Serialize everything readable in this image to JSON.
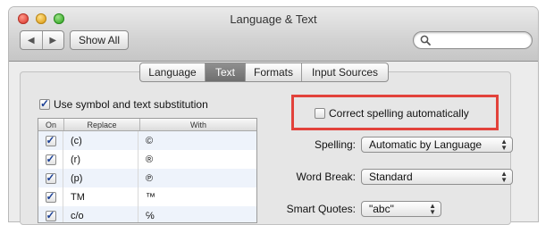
{
  "window": {
    "title": "Language & Text"
  },
  "toolbar": {
    "back_glyph": "◀",
    "forward_glyph": "▶",
    "show_all_label": "Show All",
    "search_placeholder": ""
  },
  "tabs": [
    {
      "label": "Language",
      "active": false
    },
    {
      "label": "Text",
      "active": true
    },
    {
      "label": "Formats",
      "active": false
    },
    {
      "label": "Input Sources",
      "active": false
    }
  ],
  "substitution": {
    "checkbox_label": "Use symbol and text substitution",
    "checked": true,
    "columns": [
      "On",
      "Replace",
      "With"
    ],
    "rows": [
      {
        "on": true,
        "replace": "(c)",
        "with": "©"
      },
      {
        "on": true,
        "replace": "(r)",
        "with": "®"
      },
      {
        "on": true,
        "replace": "(p)",
        "with": "℗"
      },
      {
        "on": true,
        "replace": "TM",
        "with": "™"
      },
      {
        "on": true,
        "replace": "c/o",
        "with": "℅"
      }
    ]
  },
  "spelling_options": {
    "correct_spelling_label": "Correct spelling automatically",
    "correct_spelling_checked": false,
    "spelling_label": "Spelling:",
    "spelling_value": "Automatic by Language",
    "word_break_label": "Word Break:",
    "word_break_value": "Standard",
    "smart_quotes_label": "Smart Quotes:",
    "smart_quotes_value": "\"abc\""
  },
  "colors": {
    "highlight_box": "#e2423b",
    "selected_tab": "#7a7a7a",
    "checkmark": "#1a3f95"
  },
  "icons": {
    "search": "magnifier-icon",
    "popup": "up-down-arrows-icon"
  }
}
